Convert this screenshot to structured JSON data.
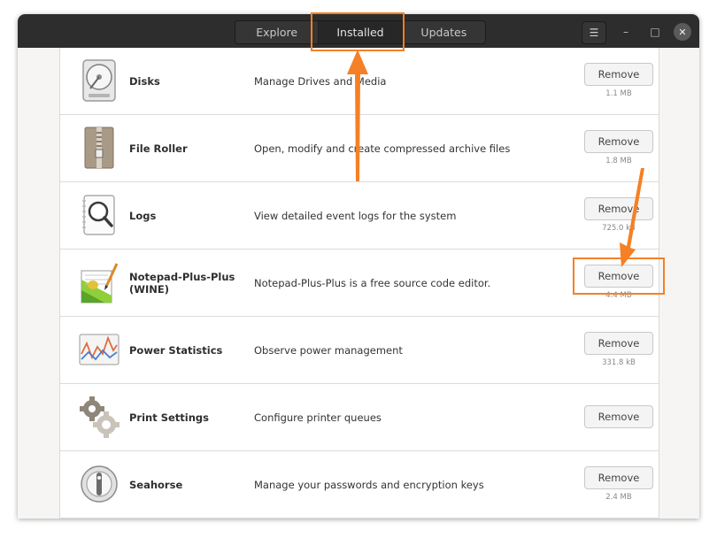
{
  "header": {
    "tabs": [
      {
        "label": "Explore"
      },
      {
        "label": "Installed"
      },
      {
        "label": "Updates"
      }
    ],
    "menu_icon": "hamburger-menu-icon",
    "window_controls": [
      "minimize-icon",
      "maximize-icon",
      "close-icon"
    ]
  },
  "apps": [
    {
      "name": "Disks",
      "description": "Manage Drives and Media",
      "button": "Remove",
      "size": "1.1 MB",
      "icon": "disks-icon"
    },
    {
      "name": "File Roller",
      "description": "Open, modify and create compressed archive files",
      "button": "Remove",
      "size": "1.8 MB",
      "icon": "archive-icon"
    },
    {
      "name": "Logs",
      "description": "View detailed event logs for the system",
      "button": "Remove",
      "size": "725.0 kB",
      "icon": "magnifier-icon"
    },
    {
      "name": "Notepad-Plus-Plus\n(WINE)",
      "description": "Notepad-Plus-Plus is a free source code editor.",
      "button": "Remove",
      "size": "4.4 MB",
      "icon": "notepad-icon"
    },
    {
      "name": "Power Statistics",
      "description": "Observe power management",
      "button": "Remove",
      "size": "331.8 kB",
      "icon": "power-graph-icon"
    },
    {
      "name": "Print Settings",
      "description": "Configure printer queues",
      "button": "Remove",
      "size": "",
      "icon": "gears-icon"
    },
    {
      "name": "Seahorse",
      "description": "Manage your passwords and encryption keys",
      "button": "Remove",
      "size": "2.4 MB",
      "icon": "keyring-icon"
    }
  ],
  "colors": {
    "titlebar": "#2d2d2d",
    "highlight": "#f58025",
    "arrow": "#f58025"
  }
}
